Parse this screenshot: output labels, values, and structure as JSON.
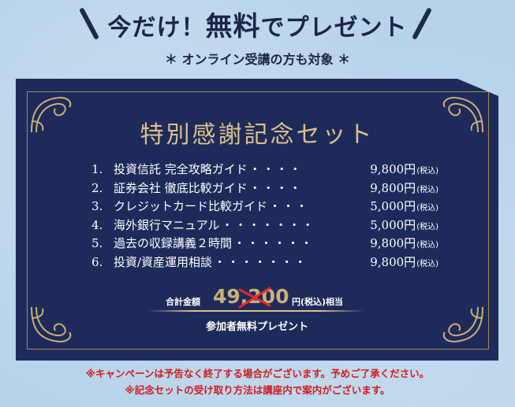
{
  "headline": {
    "part1": "今だけ！",
    "part2": "無料",
    "part3": "でプレゼント"
  },
  "subheadline": "＊ オンライン受講の方も対象 ＊",
  "panel": {
    "title": "特別感謝記念セット",
    "items": [
      {
        "num": "1.",
        "name": "投資信託 完全攻略ガイド",
        "dots": "・・・・",
        "price": "9,800円",
        "tax": "(税込)"
      },
      {
        "num": "2.",
        "name": "証券会社 徹底比較ガイド",
        "dots": "・・・・",
        "price": "9,800円",
        "tax": "(税込)"
      },
      {
        "num": "3.",
        "name": "クレジットカード比較ガイド",
        "dots": "・・・",
        "price": "5,000円",
        "tax": "(税込)"
      },
      {
        "num": "4.",
        "name": "海外銀行マニュアル",
        "dots": "・・・・・・・",
        "price": "5,000円",
        "tax": "(税込)"
      },
      {
        "num": "5.",
        "name": "過去の収録講義２時間",
        "dots": "・・・・・・",
        "price": "9,800円",
        "tax": "(税込)"
      },
      {
        "num": "6.",
        "name": "投資/資産運用相談",
        "dots": "・・・・・・・",
        "price": "9,800円",
        "tax": "(税込)"
      }
    ],
    "total_label": "合計金額",
    "total_value": "49,200",
    "total_unit": "円(税込)相当",
    "free_label": "参加者無料プレゼント"
  },
  "notes": [
    "※キャンペーンは予告なく終了する場合がございます。予めご了承ください。",
    "※記念セットの受け取り方法は講座内で案内がございます。"
  ],
  "colors": {
    "panel": "#1e2b5a",
    "gold": "#d9c08a",
    "note_red": "#d21d1d",
    "background": "#b7d3ea"
  }
}
